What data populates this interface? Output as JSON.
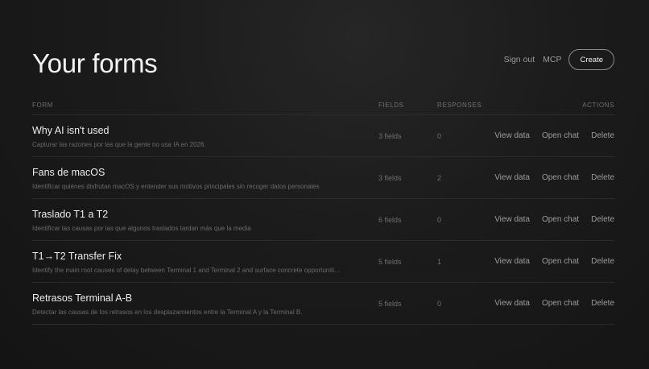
{
  "header": {
    "title": "Your forms",
    "nav": {
      "sign_out": "Sign out",
      "mcp": "MCP",
      "create": "Create"
    }
  },
  "table": {
    "columns": {
      "form": "FORM",
      "fields": "FIELDS",
      "responses": "RESPONSES",
      "actions": "ACTIONS"
    },
    "action_labels": {
      "view": "View data",
      "chat": "Open chat",
      "delete": "Delete"
    },
    "rows": [
      {
        "name": "Why AI isn't used",
        "description": "Capturar las razones por las que la gente no usa IA en 2026.",
        "fields": "3 fields",
        "responses": "0"
      },
      {
        "name": "Fans de macOS",
        "description": "Identificar quiénes disfrutan macOS y entender sus motivos principales sin recoger datos personales",
        "fields": "3 fields",
        "responses": "2"
      },
      {
        "name": "Traslado T1 a T2",
        "description": "Identificar las causas por las que algunos traslados tardan más que la media",
        "fields": "6 fields",
        "responses": "0"
      },
      {
        "name": "T1→T2 Transfer Fix",
        "description": "Identify the main root causes of delay between Terminal 1 and Terminal 2 and surface concrete opportuniti…",
        "fields": "5 fields",
        "responses": "1"
      },
      {
        "name": "Retrasos Terminal A-B",
        "description": "Detectar las causas de los retrasos en los desplazamientos entre la Terminal A y la Terminal B.",
        "fields": "5 fields",
        "responses": "0"
      }
    ]
  }
}
